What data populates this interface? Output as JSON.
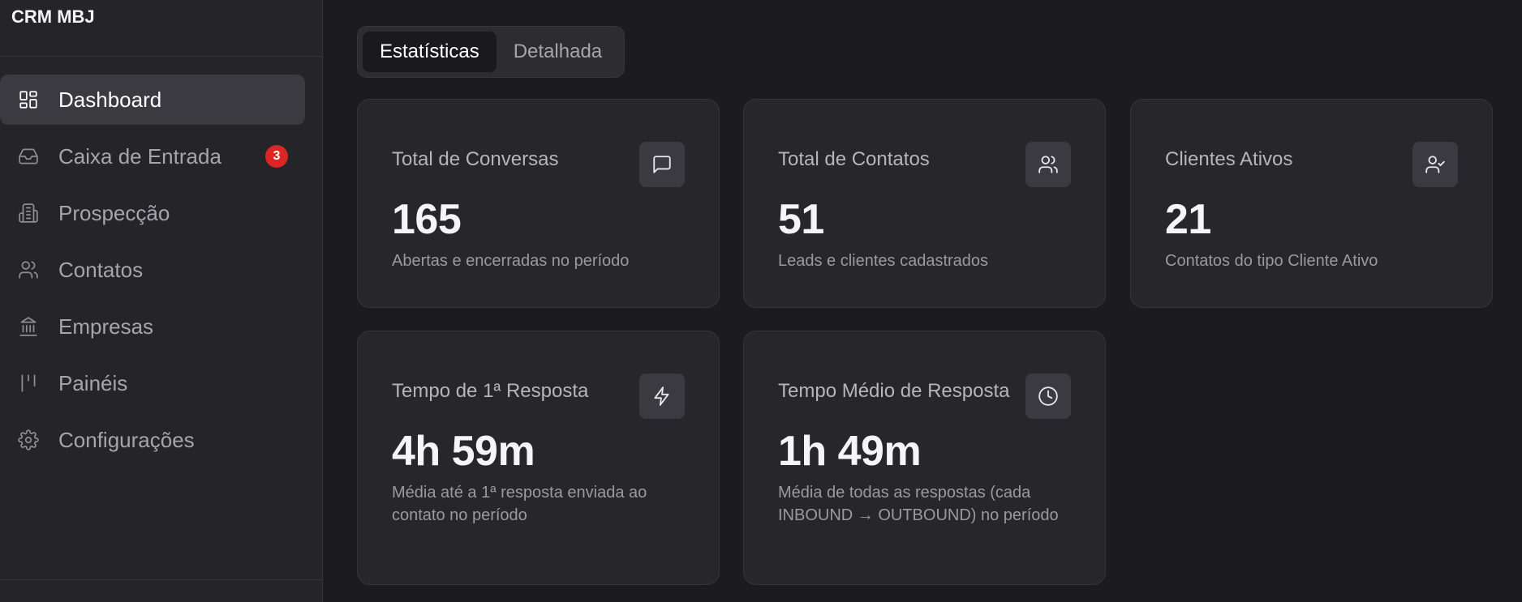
{
  "app": {
    "brand": "CRM MBJ"
  },
  "sidebar": {
    "items": [
      {
        "label": "Dashboard",
        "icon": "dashboard-grid-icon",
        "active": true
      },
      {
        "label": "Caixa de Entrada",
        "icon": "inbox-icon",
        "badge": "3"
      },
      {
        "label": "Prospecção",
        "icon": "building-icon"
      },
      {
        "label": "Contatos",
        "icon": "users-icon"
      },
      {
        "label": "Empresas",
        "icon": "bank-icon"
      },
      {
        "label": "Painéis",
        "icon": "kanban-icon"
      },
      {
        "label": "Configurações",
        "icon": "gear-icon"
      }
    ]
  },
  "tabs": [
    {
      "label": "Estatísticas",
      "active": true
    },
    {
      "label": "Detalhada",
      "active": false
    }
  ],
  "cards": [
    {
      "title": "Total de Conversas",
      "value": "165",
      "description": "Abertas e encerradas no período",
      "icon": "message-icon"
    },
    {
      "title": "Total de Contatos",
      "value": "51",
      "description": "Leads e clientes cadastrados",
      "icon": "users-icon"
    },
    {
      "title": "Clientes Ativos",
      "value": "21",
      "description": "Contatos do tipo Cliente Ativo",
      "icon": "user-check-icon"
    },
    {
      "title": "Tempo de 1ª Resposta",
      "value": "4h 59m",
      "description": "Média até a 1ª resposta enviada ao contato no período",
      "icon": "lightning-icon"
    },
    {
      "title": "Tempo Médio de Resposta",
      "value": "1h 49m",
      "description": "Média de todas as respostas (cada INBOUND → OUTBOUND) no período",
      "icon": "clock-icon"
    }
  ],
  "colors": {
    "background": "#1c1c20",
    "sidebar": "#252529",
    "card": "#26262b",
    "badge": "#dc2626"
  }
}
